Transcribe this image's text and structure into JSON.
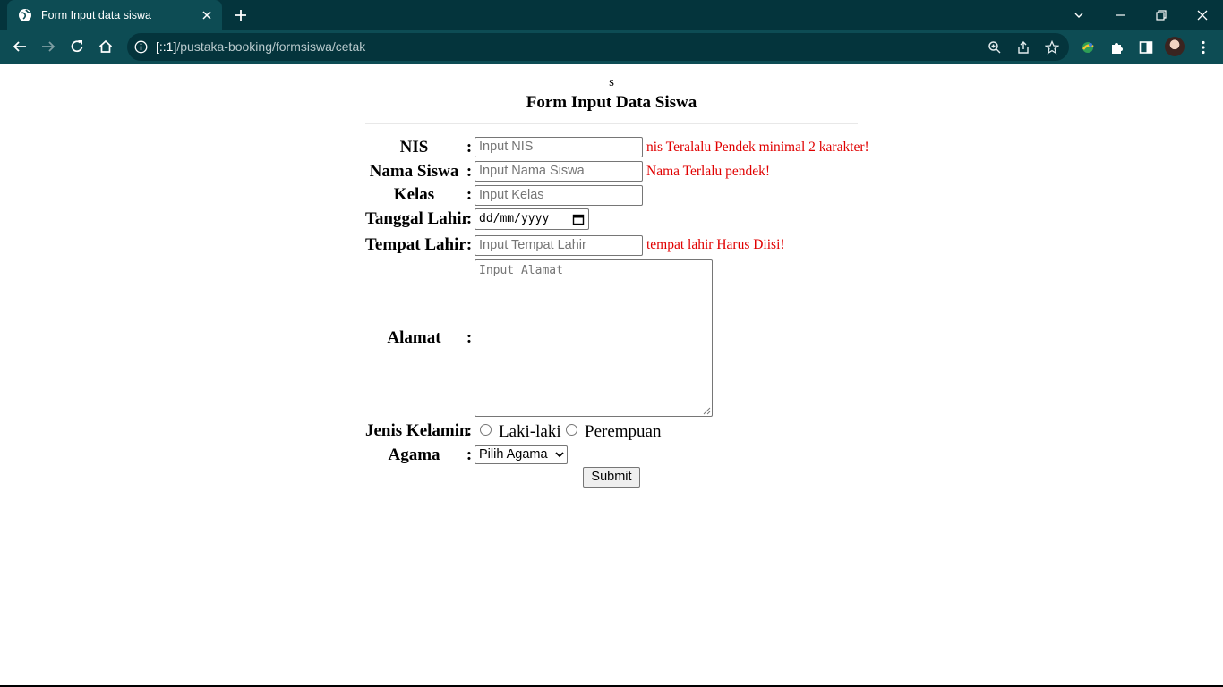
{
  "browser": {
    "tab_title": "Form Input data siswa",
    "url_host": "[::1]",
    "url_path": "/pustaka-booking/formsiswa/cetak"
  },
  "page": {
    "stray_text": "s",
    "title": "Form Input Data Siswa",
    "fields": {
      "nis": {
        "label": "NIS",
        "colon": ":",
        "placeholder": "Input NIS",
        "error": "nis Teralalu Pendek minimal 2 karakter!"
      },
      "nama": {
        "label": "Nama Siswa",
        "colon": ":",
        "placeholder": "Input Nama Siswa",
        "error": "Nama Terlalu pendek!"
      },
      "kelas": {
        "label": "Kelas",
        "colon": ":",
        "placeholder": "Input Kelas"
      },
      "tanggal": {
        "label": "Tanggal Lahir",
        "colon": ":",
        "value": "dd/mm/yyyy"
      },
      "tempat": {
        "label": "Tempat Lahir",
        "colon": ":",
        "placeholder": "Input Tempat Lahir",
        "error": "tempat lahir Harus Diisi!"
      },
      "alamat": {
        "label": "Alamat",
        "colon": ":",
        "placeholder": "Input Alamat"
      },
      "jenis_kelamin": {
        "label": "Jenis Kelamin",
        "colon": ":",
        "options": [
          "Laki-laki",
          "Perempuan"
        ]
      },
      "agama": {
        "label": "Agama",
        "colon": ":",
        "selected": "Pilih Agama"
      }
    },
    "submit_label": "Submit"
  },
  "colors": {
    "titlebar": "#04343c",
    "toolbar": "#0d4c54",
    "error": "#e00000"
  },
  "icons": [
    "globe-icon",
    "close-icon",
    "plus-icon",
    "chevron-down-icon",
    "minimize-icon",
    "restore-icon",
    "back-icon",
    "forward-icon",
    "reload-icon",
    "home-icon",
    "info-icon",
    "zoom-icon",
    "share-icon",
    "star-icon",
    "extension-icon",
    "puzzle-icon",
    "sidepanel-icon",
    "menu-icon",
    "calendar-icon"
  ]
}
